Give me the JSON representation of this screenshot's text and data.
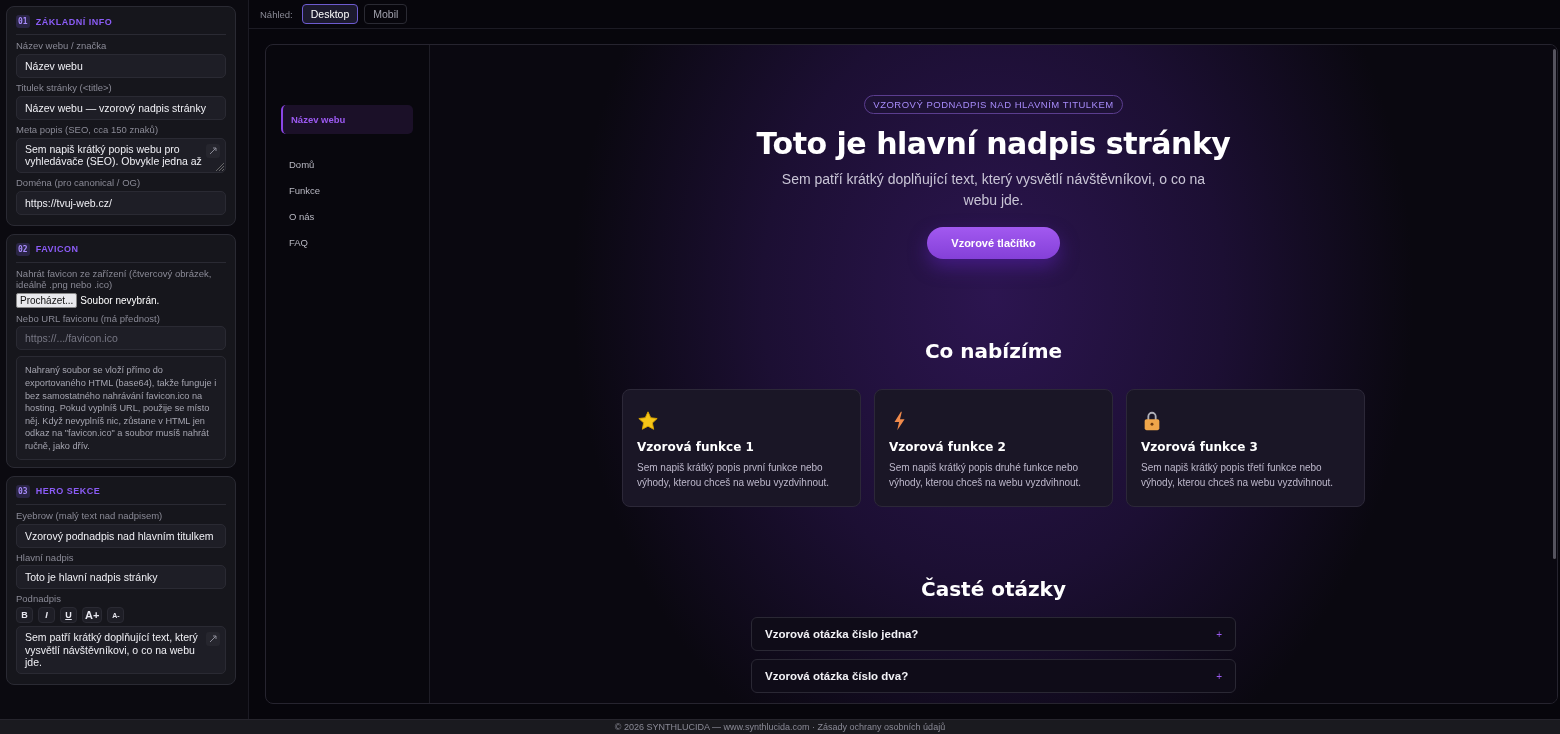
{
  "sidebar": {
    "sections": [
      {
        "number": "01",
        "title": "ZÁKLADNÍ INFO",
        "fields": [
          {
            "kind": "text",
            "label": "Název webu / značka",
            "value": "Název webu"
          },
          {
            "kind": "text",
            "label": "Titulek stránky (<title>)",
            "value": "Název webu — vzorový nadpis stránky"
          },
          {
            "kind": "textarea",
            "label": "Meta popis (SEO, cca 150 znaků)",
            "value": "Sem napiš krátký popis webu pro vyhledávače (SEO). Obvykle jedna až"
          },
          {
            "kind": "text",
            "label": "Doména (pro canonical / OG)",
            "value": "https://tvuj-web.cz/"
          }
        ]
      },
      {
        "number": "02",
        "title": "FAVICON",
        "fields": [
          {
            "kind": "file",
            "label": "Nahrát favicon ze zařízení (čtvercový obrázek, ideálně .png nebo .ico)",
            "button": "Procházet...",
            "status": "Soubor nevybrán."
          },
          {
            "kind": "text",
            "label": "Nebo URL faviconu (má přednost)",
            "placeholder": "https://.../favicon.ico"
          },
          {
            "kind": "note",
            "text": "Nahraný soubor se vloží přímo do exportovaného HTML (base64), takže funguje i bez samostatného nahrávání favicon.ico na hosting. Pokud vyplníš URL, použije se místo něj. Když nevyplníš nic, zůstane v HTML jen odkaz na \"favicon.ico\" a soubor musíš nahrát ručně, jako dřív."
          }
        ]
      },
      {
        "number": "03",
        "title": "HERO SEKCE",
        "fields": [
          {
            "kind": "text",
            "label": "Eyebrow (malý text nad nadpisem)",
            "value": "Vzorový podnadpis nad hlavním titulkem"
          },
          {
            "kind": "text",
            "label": "Hlavní nadpis",
            "value": "Toto je hlavní nadpis stránky"
          },
          {
            "kind": "richtext",
            "label": "Podnadpis",
            "tools": [
              "B",
              "I",
              "U",
              "A+",
              "A-"
            ],
            "value": "Sem patří krátký doplňující text, který vysvětlí návštěvníkovi, o co na webu jde."
          }
        ]
      }
    ]
  },
  "preview_bar": {
    "label": "Náhled:",
    "modes": [
      {
        "label": "Desktop",
        "selected": true
      },
      {
        "label": "Mobil",
        "selected": false
      }
    ]
  },
  "site": {
    "brand": "Název webu",
    "nav": [
      "Domů",
      "Funkce",
      "O nás",
      "FAQ"
    ],
    "hero": {
      "eyebrow": "VZOROVÝ PODNADPIS NAD HLAVNÍM TITULKEM",
      "title": "Toto je hlavní nadpis stránky",
      "subtitle": "Sem patří krátký doplňující text, který vysvětlí návštěvníkovi, o co na webu jde.",
      "button": "Vzorové tlačítko"
    },
    "features": {
      "title": "Co nabízíme",
      "cards": [
        {
          "kind": "star",
          "title": "Vzorová funkce 1",
          "text": "Sem napiš krátký popis první funkce nebo výhody, kterou chceš na webu vyzdvihnout."
        },
        {
          "kind": "bolt",
          "title": "Vzorová funkce 2",
          "text": "Sem napiš krátký popis druhé funkce nebo výhody, kterou chceš na webu vyzdvihnout."
        },
        {
          "kind": "lock",
          "title": "Vzorová funkce 3",
          "text": "Sem napiš krátký popis třetí funkce nebo výhody, kterou chceš na webu vyzdvihnout."
        }
      ]
    },
    "faq": {
      "title": "Časté otázky",
      "items": [
        {
          "question": "Vzorová otázka číslo jedna?",
          "toggle": "+"
        },
        {
          "question": "Vzorová otázka číslo dva?",
          "toggle": "+"
        }
      ]
    }
  },
  "footer": "© 2026 SYNTHLUCIDA — www.synthlucida.com · Zásady ochrany osobních údajů"
}
